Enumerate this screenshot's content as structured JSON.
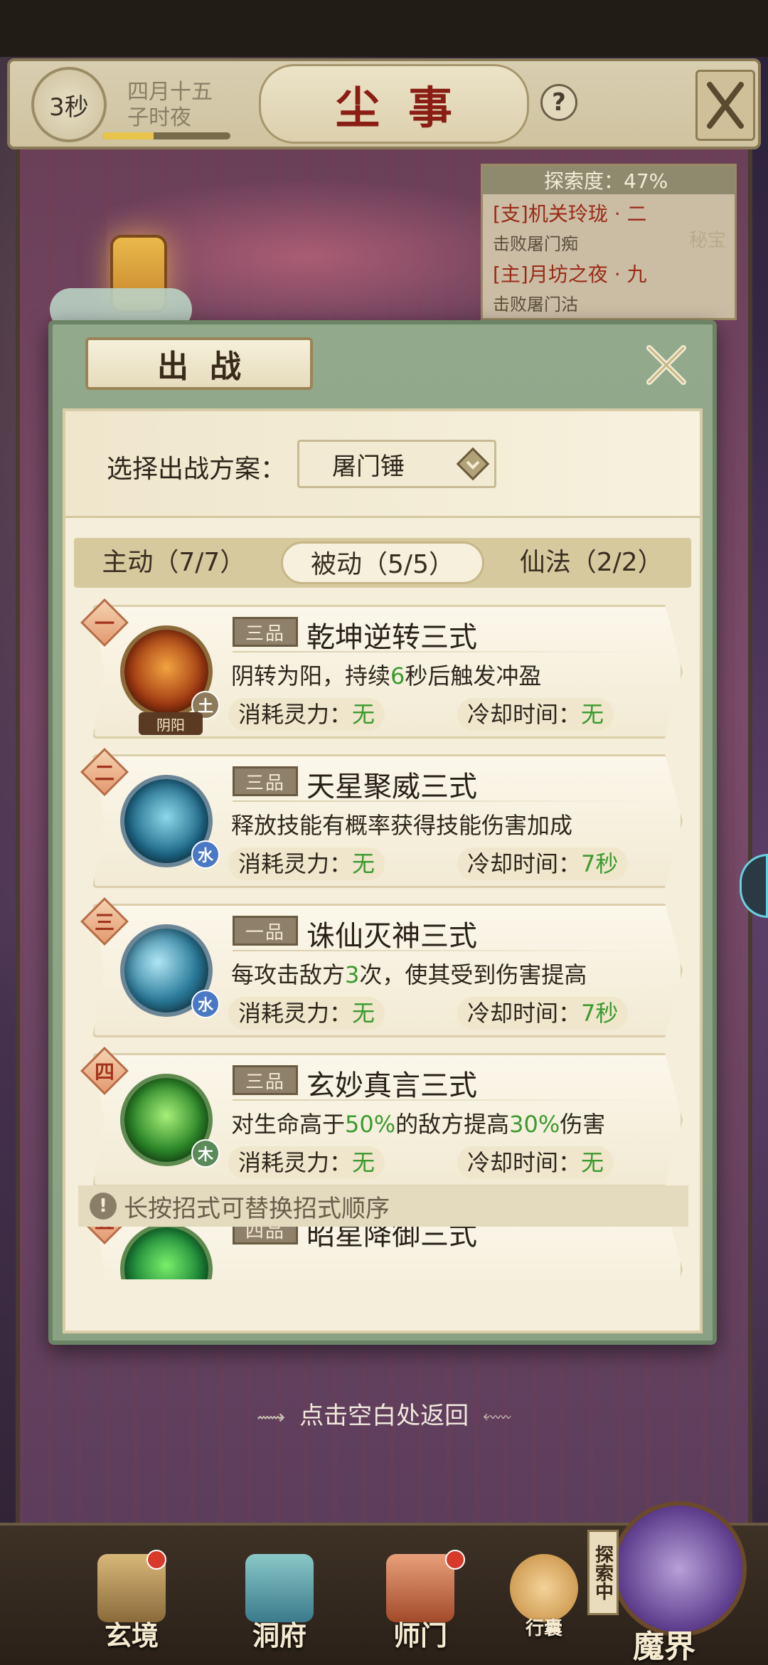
{
  "header": {
    "timer": "3秒",
    "date_line1": "四月十五",
    "date_line2": "子时夜",
    "time_progress": 0.4,
    "title": "尘事",
    "help_symbol": "?"
  },
  "explore": {
    "label": "探索度：47%",
    "items": [
      {
        "title": "[支]机关玲珑 · 二",
        "sub": "击败屠门痴",
        "tag": "秘宝"
      },
      {
        "title": "[主]月坊之夜 · 九",
        "sub": "击败屠门沽"
      }
    ]
  },
  "dialog": {
    "tab_title": "出战",
    "scheme_label": "选择出战方案：",
    "scheme_value": "屠门锤",
    "tabs": [
      {
        "label": "主动（7/7）",
        "active": false
      },
      {
        "label": "被动（5/5）",
        "active": true
      },
      {
        "label": "仙法（2/2）",
        "active": false
      }
    ],
    "skills": [
      {
        "num": "一",
        "grade": "三品",
        "name": "乾坤逆转三式",
        "desc_parts": [
          "阴转为阳，持续",
          "6",
          "秒后触发冲盈"
        ],
        "element": "土",
        "extra_badge": "阴阳",
        "mp_label": "消耗灵力：",
        "mp_value": "无",
        "cd_label": "冷却时间：",
        "cd_value": "无"
      },
      {
        "num": "二",
        "grade": "三品",
        "name": "天星聚威三式",
        "desc_parts": [
          "释放技能有概率获得技能伤害加成",
          "",
          ""
        ],
        "element": "水",
        "mp_label": "消耗灵力：",
        "mp_value": "无",
        "cd_label": "冷却时间：",
        "cd_value": "7秒"
      },
      {
        "num": "三",
        "grade": "一品",
        "name": "诛仙灭神三式",
        "desc_parts": [
          "每攻击敌方",
          "3",
          "次，使其受到伤害提高"
        ],
        "element": "水",
        "mp_label": "消耗灵力：",
        "mp_value": "无",
        "cd_label": "冷却时间：",
        "cd_value": "7秒"
      },
      {
        "num": "四",
        "grade": "三品",
        "name": "玄妙真言三式",
        "desc_parts": [
          "对生命高于",
          "50%",
          "的敌方提高",
          "30%",
          "伤害"
        ],
        "element": "木",
        "mp_label": "消耗灵力：",
        "mp_value": "无",
        "cd_label": "冷却时间：",
        "cd_value": "无"
      },
      {
        "num": "五",
        "grade": "四品",
        "name": "昭星降御三式"
      }
    ],
    "hint_symbol": "!",
    "hint": "长按招式可替换招式顺序"
  },
  "return_hint": "点击空白处返回",
  "bottom_nav": [
    {
      "label": "玄境",
      "dot": true
    },
    {
      "label": "洞府",
      "dot": false
    },
    {
      "label": "师门",
      "dot": true
    },
    {
      "label": "行囊",
      "dot": false
    }
  ],
  "explore_bag": {
    "vertical": "探索中",
    "label": "魔界"
  },
  "colors": {
    "green_value": "#3c9a2e",
    "title_red": "#8a1d14",
    "panel_green": "#8aa283",
    "parchment": "#f4eedb"
  }
}
